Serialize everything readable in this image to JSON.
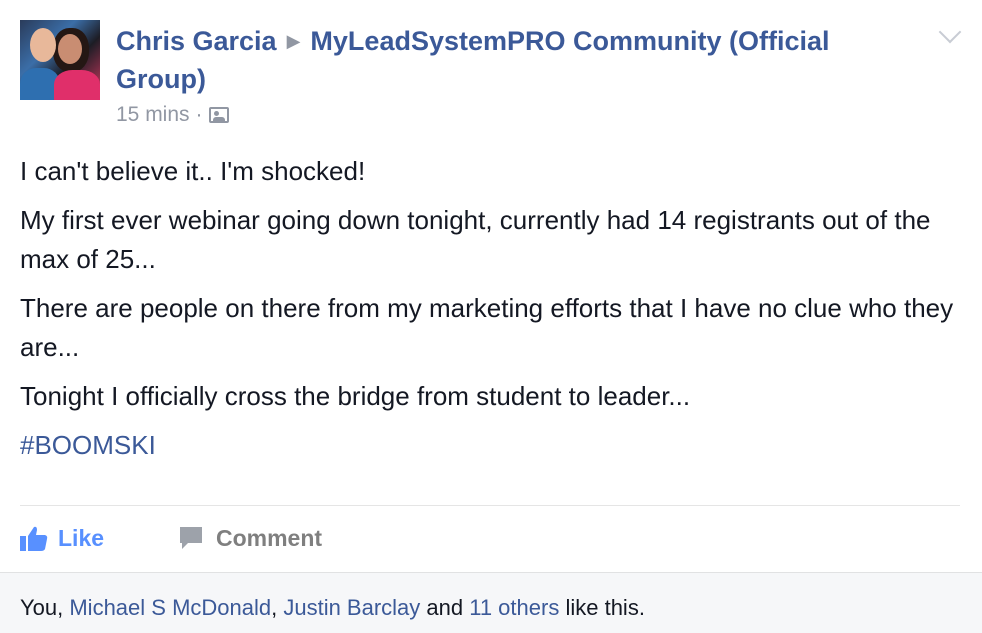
{
  "post": {
    "author": "Chris Garcia",
    "group": "MyLeadSystemPRO Community (Official Group)",
    "timestamp": "15 mins",
    "separator": "·",
    "audience_icon": "group-members-icon",
    "paragraphs": [
      "I can't believe it.. I'm shocked!",
      "My first ever webinar going down tonight, currently had 14 registrants out of the max of 25...",
      "There are people on there from my marketing efforts that I have no clue who they are...",
      "Tonight I officially cross the bridge from student to leader..."
    ],
    "hashtag": "#BOOMSKI"
  },
  "actions": {
    "like_label": "Like",
    "comment_label": "Comment"
  },
  "likes": {
    "you": "You, ",
    "person1": "Michael S McDonald",
    "comma": ", ",
    "person2": "Justin Barclay",
    "and": " and ",
    "others": "11 others",
    "suffix": " like this."
  },
  "colors": {
    "link": "#3b5998",
    "like_blue": "#5890ff",
    "muted": "#9197a3",
    "text": "#141823"
  }
}
